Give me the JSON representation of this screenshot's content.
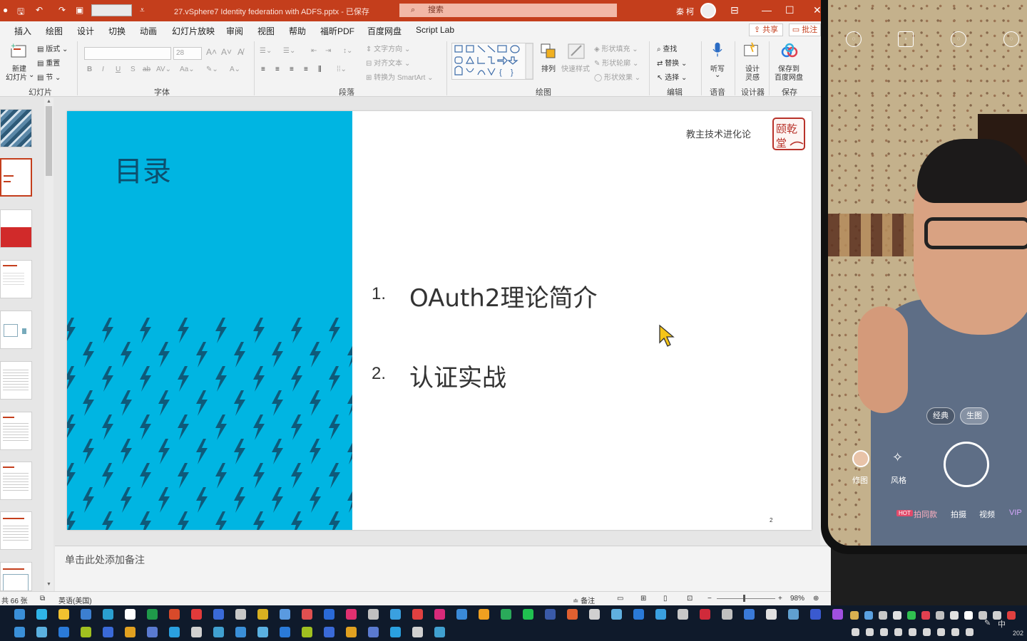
{
  "titlebar": {
    "doc_title": "27.vSphere7 Identity federation with ADFS.pptx - 已保存",
    "search_placeholder": "搜索",
    "user": "秦 柯"
  },
  "tabs": [
    "插入",
    "绘图",
    "设计",
    "切换",
    "动画",
    "幻灯片放映",
    "审阅",
    "视图",
    "帮助",
    "福昕PDF",
    "百度网盘",
    "Script Lab"
  ],
  "share_label": "共享",
  "comments_label": "批注",
  "ribbon": {
    "slides": {
      "new_slide": "新建",
      "new_slide2": "幻灯片",
      "layout": "版式",
      "reset": "重置",
      "section": "节",
      "label": "幻灯片"
    },
    "font": {
      "size": "28",
      "label": "字体"
    },
    "paragraph": {
      "text_direction": "文字方向",
      "align_text": "对齐文本",
      "smartart": "转换为 SmartArt",
      "label": "段落"
    },
    "drawing": {
      "arrange": "排列",
      "quick_styles": "快速样式",
      "shape_fill": "形状填充",
      "shape_outline": "形状轮廓",
      "shape_effects": "形状效果",
      "label": "绘图"
    },
    "editing": {
      "find": "查找",
      "replace": "替换",
      "select": "选择",
      "label": "编辑"
    },
    "voice": {
      "dictate": "听写",
      "label": "语音"
    },
    "designer": {
      "ideas": "设计",
      "ideas2": "灵感",
      "label": "设计器"
    },
    "save": {
      "baidu": "保存到",
      "baidu2": "百度网盘",
      "label": "保存"
    }
  },
  "slide": {
    "title": "目录",
    "brand": "教主技术进化论",
    "seal_text": "乾颐堂",
    "items": [
      {
        "num": "1.",
        "text": "OAuth2理论简介"
      },
      {
        "num": "2.",
        "text": "认证实战"
      }
    ],
    "page_number": "2"
  },
  "notes_placeholder": "单击此处添加备注",
  "statusbar": {
    "slide_count": "共 66 张",
    "language": "英语(美国)",
    "notes": "备注",
    "zoom": "98%"
  },
  "phone": {
    "modes": [
      "拍同款",
      "拍摄",
      "视频",
      "VIP"
    ],
    "retouch": "修图",
    "style": "风格",
    "classic": "经典",
    "generate": "生图",
    "hot_badge": "HOT"
  },
  "taskbar": {
    "ime": "中",
    "year_fragment": "202"
  },
  "colors": {
    "accent": "#c43e1c",
    "slide_blue": "#00b5e2",
    "bolt": "#0e5a7a"
  }
}
